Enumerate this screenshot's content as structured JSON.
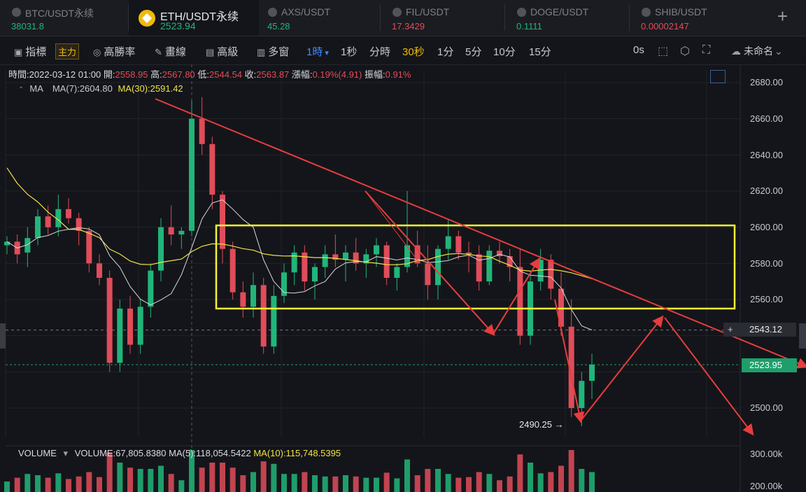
{
  "tabs": [
    {
      "name": "BTC/USDT永续",
      "price": "38031.8",
      "price_color": "#21b57a"
    },
    {
      "name": "ETH/USDT永续",
      "price": "2523.94",
      "price_color": "#21b57a"
    },
    {
      "name": "AXS/USDT",
      "price": "45.28",
      "price_color": "#21b57a"
    },
    {
      "name": "FIL/USDT",
      "price": "17.3429",
      "price_color": "#e04c5a"
    },
    {
      "name": "DOGE/USDT",
      "price": "0.1111",
      "price_color": "#21b57a"
    },
    {
      "name": "SHIB/USDT",
      "price": "0.00002147",
      "price_color": "#e04c5a"
    }
  ],
  "toolbar": {
    "indicator": "指標",
    "main_badge": "主力",
    "win_rate": "高勝率",
    "draw": "畫線",
    "advanced": "高級",
    "multi_window": "多窗",
    "interval_selected": "1時",
    "intervals": [
      "1秒",
      "分時",
      "30秒",
      "1分",
      "5分",
      "10分",
      "15分"
    ],
    "countdown": "0s",
    "layout_name": "未命名"
  },
  "ohlc": {
    "time_label": "時間:",
    "time": "2022-03-12 01:00",
    "open_label": "開:",
    "open": "2558.95",
    "high_label": "高:",
    "high": "2567.80",
    "low_label": "低:",
    "low": "2544.54",
    "close_label": "收:",
    "close": "2563.87",
    "change_label": "漲幅:",
    "change": "0.19%(4.91)",
    "amp_label": "振幅:",
    "amp": "0.91%"
  },
  "ma_legend": {
    "title": "MA",
    "ma7": "MA(7):2604.80",
    "ma30": "MA(30):2591.42"
  },
  "volume_legend": {
    "title": "VOLUME",
    "volume": "VOLUME:67,805.8380",
    "ma5": "MA(5):118,054.5422",
    "ma10": "MA(10):115,748.5395"
  },
  "price_axis": [
    "2680.00",
    "2660.00",
    "2640.00",
    "2620.00",
    "2600.00",
    "2580.00",
    "2560.00",
    "2500.00"
  ],
  "volume_axis": [
    "300.00k",
    "200.00k"
  ],
  "crosshair_price": "2543.12",
  "last_price": "2523.95",
  "low_marker": "2490.25",
  "colors": {
    "up": "#21b57a",
    "down": "#e04c5a",
    "ma7": "#d9d9d9",
    "ma30": "#f0e443",
    "box": "#f5f531",
    "trend": "#e63e3e"
  },
  "chart_data": {
    "type": "candlestick",
    "y_unit": "USDT",
    "ylim": [
      2480,
      2688
    ],
    "candles": [
      [
        2590,
        2595,
        2585,
        2592
      ],
      [
        2592,
        2596,
        2580,
        2585
      ],
      [
        2586,
        2600,
        2578,
        2594
      ],
      [
        2594,
        2610,
        2590,
        2606
      ],
      [
        2606,
        2612,
        2596,
        2600
      ],
      [
        2600,
        2618,
        2595,
        2610
      ],
      [
        2610,
        2616,
        2602,
        2605
      ],
      [
        2605,
        2608,
        2590,
        2598
      ],
      [
        2598,
        2600,
        2575,
        2580
      ],
      [
        2580,
        2585,
        2568,
        2572
      ],
      [
        2572,
        2576,
        2520,
        2525
      ],
      [
        2525,
        2560,
        2520,
        2555
      ],
      [
        2555,
        2562,
        2530,
        2535
      ],
      [
        2535,
        2560,
        2530,
        2556
      ],
      [
        2556,
        2580,
        2550,
        2576
      ],
      [
        2576,
        2605,
        2570,
        2600
      ],
      [
        2600,
        2612,
        2590,
        2596
      ],
      [
        2596,
        2600,
        2588,
        2598
      ],
      [
        2598,
        2670,
        2595,
        2660
      ],
      [
        2660,
        2672,
        2640,
        2646
      ],
      [
        2646,
        2650,
        2610,
        2618
      ],
      [
        2618,
        2620,
        2580,
        2588
      ],
      [
        2588,
        2592,
        2560,
        2564
      ],
      [
        2564,
        2570,
        2550,
        2556
      ],
      [
        2556,
        2575,
        2550,
        2568
      ],
      [
        2568,
        2572,
        2530,
        2534
      ],
      [
        2534,
        2568,
        2530,
        2562
      ],
      [
        2562,
        2580,
        2558,
        2575
      ],
      [
        2575,
        2590,
        2568,
        2586
      ],
      [
        2586,
        2590,
        2565,
        2570
      ],
      [
        2570,
        2580,
        2560,
        2578
      ],
      [
        2578,
        2590,
        2572,
        2585
      ],
      [
        2585,
        2596,
        2578,
        2582
      ],
      [
        2582,
        2590,
        2570,
        2586
      ],
      [
        2586,
        2594,
        2576,
        2580
      ],
      [
        2580,
        2588,
        2572,
        2585
      ],
      [
        2585,
        2594,
        2578,
        2590
      ],
      [
        2590,
        2592,
        2568,
        2572
      ],
      [
        2572,
        2580,
        2565,
        2578
      ],
      [
        2578,
        2620,
        2575,
        2590
      ],
      [
        2590,
        2598,
        2578,
        2580
      ],
      [
        2580,
        2590,
        2560,
        2568
      ],
      [
        2568,
        2590,
        2560,
        2588
      ],
      [
        2588,
        2604,
        2582,
        2595
      ],
      [
        2595,
        2598,
        2582,
        2586
      ],
      [
        2586,
        2592,
        2575,
        2585
      ],
      [
        2585,
        2590,
        2565,
        2570
      ],
      [
        2570,
        2590,
        2568,
        2587
      ],
      [
        2587,
        2592,
        2580,
        2584
      ],
      [
        2584,
        2588,
        2570,
        2578
      ],
      [
        2578,
        2588,
        2535,
        2540
      ],
      [
        2540,
        2575,
        2535,
        2570
      ],
      [
        2570,
        2588,
        2565,
        2582
      ],
      [
        2582,
        2585,
        2560,
        2566
      ],
      [
        2566,
        2575,
        2540,
        2545
      ],
      [
        2545,
        2560,
        2495,
        2500
      ],
      [
        2500,
        2520,
        2490,
        2515
      ],
      [
        2515,
        2530,
        2505,
        2524
      ]
    ],
    "annotations": {
      "box_price_range": [
        2555,
        2601
      ],
      "low": 2490.25,
      "crosshair": 2543.12,
      "last": 2523.95
    }
  }
}
